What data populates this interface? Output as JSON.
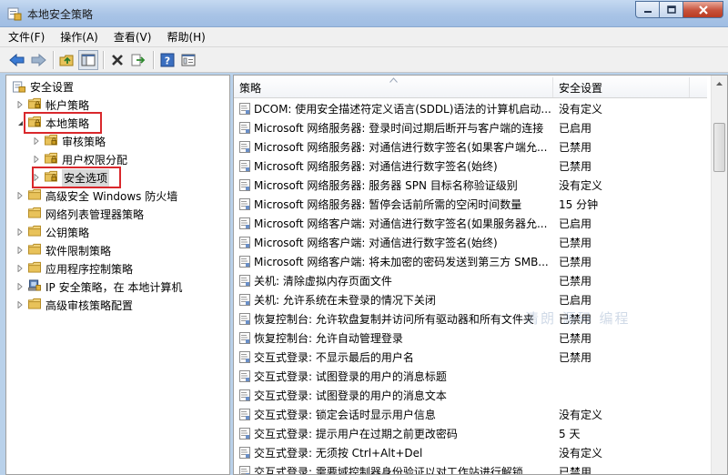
{
  "window": {
    "title": "本地安全策略"
  },
  "menu": [
    "文件(F)",
    "操作(A)",
    "查看(V)",
    "帮助(H)"
  ],
  "toolbar": [
    "back-icon",
    "forward-icon",
    "up-folder-icon",
    "show-tree-icon",
    "delete-icon",
    "export-icon",
    "help-icon",
    "properties-icon"
  ],
  "tree": {
    "root": "安全设置",
    "items": [
      {
        "label": "帐户策略",
        "level": 1,
        "expandable": true,
        "expanded": false
      },
      {
        "label": "本地策略",
        "level": 1,
        "expandable": true,
        "expanded": true,
        "highlighted": true
      },
      {
        "label": "审核策略",
        "level": 2,
        "expandable": true,
        "expanded": false
      },
      {
        "label": "用户权限分配",
        "level": 2,
        "expandable": true,
        "expanded": false
      },
      {
        "label": "安全选项",
        "level": 2,
        "expandable": true,
        "expanded": false,
        "selected": true,
        "highlighted": true
      },
      {
        "label": "高级安全 Windows 防火墙",
        "level": 1,
        "expandable": true,
        "expanded": false
      },
      {
        "label": "网络列表管理器策略",
        "level": 1,
        "expandable": false,
        "expanded": false
      },
      {
        "label": "公钥策略",
        "level": 1,
        "expandable": true,
        "expanded": false
      },
      {
        "label": "软件限制策略",
        "level": 1,
        "expandable": true,
        "expanded": false
      },
      {
        "label": "应用程序控制策略",
        "level": 1,
        "expandable": true,
        "expanded": false
      },
      {
        "label": "IP 安全策略，在 本地计算机",
        "level": 1,
        "expandable": true,
        "expanded": false,
        "icon": "ip-security-icon"
      },
      {
        "label": "高级审核策略配置",
        "level": 1,
        "expandable": true,
        "expanded": false
      }
    ]
  },
  "list": {
    "columns": [
      "策略",
      "安全设置"
    ],
    "rows": [
      [
        "DCOM: 使用安全描述符定义语言(SDDL)语法的计算机启动...",
        "没有定义"
      ],
      [
        "Microsoft 网络服务器: 登录时间过期后断开与客户端的连接",
        "已启用"
      ],
      [
        "Microsoft 网络服务器: 对通信进行数字签名(如果客户端允...",
        "已禁用"
      ],
      [
        "Microsoft 网络服务器: 对通信进行数字签名(始终)",
        "已禁用"
      ],
      [
        "Microsoft 网络服务器: 服务器 SPN 目标名称验证级别",
        "没有定义"
      ],
      [
        "Microsoft 网络服务器: 暂停会话前所需的空闲时间数量",
        "15 分钟"
      ],
      [
        "Microsoft 网络客户端: 对通信进行数字签名(如果服务器允...",
        "已启用"
      ],
      [
        "Microsoft 网络客户端: 对通信进行数字签名(始终)",
        "已禁用"
      ],
      [
        "Microsoft 网络客户端: 将未加密的密码发送到第三方 SMB...",
        "已禁用"
      ],
      [
        "关机: 清除虚拟内存页面文件",
        "已禁用"
      ],
      [
        "关机: 允许系统在未登录的情况下关闭",
        "已启用"
      ],
      [
        "恢复控制台: 允许软盘复制并访问所有驱动器和所有文件夹",
        "已禁用"
      ],
      [
        "恢复控制台: 允许自动管理登录",
        "已禁用"
      ],
      [
        "交互式登录: 不显示最后的用户名",
        "已禁用"
      ],
      [
        "交互式登录: 试图登录的用户的消息标题",
        ""
      ],
      [
        "交互式登录: 试图登录的用户的消息文本",
        ""
      ],
      [
        "交互式登录: 锁定会话时显示用户信息",
        "没有定义"
      ],
      [
        "交互式登录: 提示用户在过期之前更改密码",
        "5 天"
      ],
      [
        "交互式登录: 无须按 Ctrl+Alt+Del",
        "没有定义"
      ],
      [
        "交互式登录: 需要域控制器身份验证以对工作站进行解锁",
        "已禁用"
      ]
    ]
  },
  "watermark": "清朗 源码 编程",
  "colors": {
    "highlight_border": "#d9282c",
    "folder": "#e8c25a",
    "chrome": "#f0f0f0"
  }
}
